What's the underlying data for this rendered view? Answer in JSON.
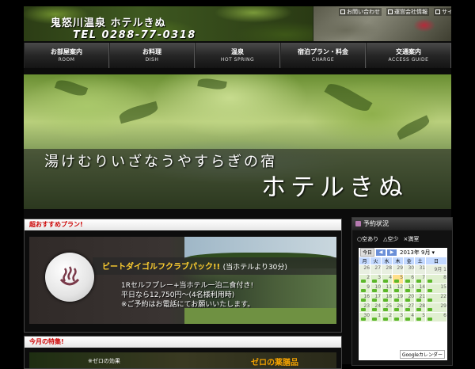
{
  "header": {
    "hotel_name": "鬼怒川温泉 ホテルきぬ",
    "tel": "TEL 0288-77-0318",
    "toplinks": [
      "お問い合わせ",
      "運営会社情報",
      "サイトマップ"
    ]
  },
  "nav": [
    {
      "jp": "お部屋案内",
      "en": "ROOM"
    },
    {
      "jp": "お料理",
      "en": "DISH"
    },
    {
      "jp": "温泉",
      "en": "HOT SPRING"
    },
    {
      "jp": "宿泊プラン・料金",
      "en": "CHARGE"
    },
    {
      "jp": "交通案内",
      "en": "ACCESS GUIDE"
    }
  ],
  "hero": {
    "catch": "湯けむりいざなうやすらぎの宿",
    "brand": "ホテルきぬ"
  },
  "plan": {
    "heading": "超おすすめプラン!",
    "title": "ビートダイゴルフクラブパック!!",
    "title_sub": "(当ホテルより30分)",
    "desc1": "1Rセルフプレー+当ホテル一泊二食付き!",
    "desc2": "平日なら12,750円～(4名様利用時)",
    "desc3": "※ご予約はお電話にてお願いいたします。"
  },
  "feature": {
    "heading": "今月の特集!",
    "left_text": "※ゼロの効果",
    "right_text": "ゼロの薬膳品"
  },
  "sidebar": {
    "heading": "予約状況",
    "legend": [
      "○空あり",
      "△空少",
      "×満室"
    ],
    "calendar": {
      "today_label": "今日",
      "month": "2013年 9月",
      "weekdays": [
        "月",
        "火",
        "水",
        "木",
        "金",
        "土",
        "日"
      ],
      "rows": [
        [
          "26",
          "27",
          "28",
          "29",
          "30",
          "31",
          "9月 1"
        ],
        [
          "2",
          "3",
          "4",
          "5",
          "6",
          "7",
          "8"
        ],
        [
          "9",
          "10",
          "11",
          "12",
          "13",
          "14",
          "15"
        ],
        [
          "16",
          "17",
          "18",
          "19",
          "20",
          "21",
          "22"
        ],
        [
          "23",
          "24",
          "25",
          "26",
          "27",
          "28",
          "29"
        ],
        [
          "30",
          "1",
          "2",
          "3",
          "4",
          "5",
          "6"
        ]
      ],
      "google_label": "Googleカレンダー"
    }
  },
  "colors": {
    "accent_red": "#cc0000",
    "gold": "#ffcf30",
    "green": "#5cb82a"
  }
}
